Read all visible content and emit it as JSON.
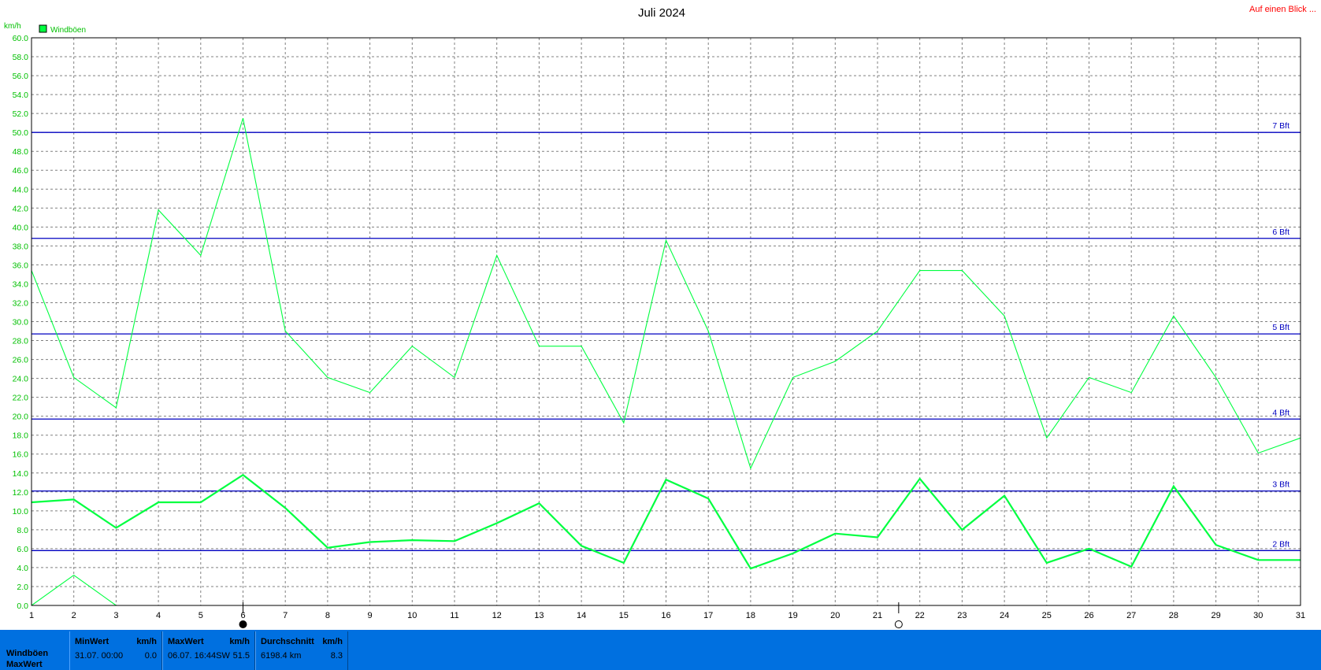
{
  "chart_data": {
    "type": "line",
    "title": "Juli 2024",
    "ylabel": "km/h",
    "xlabel": "",
    "ylim": [
      0,
      60
    ],
    "yticks": [
      "0.0",
      "2.0",
      "4.0",
      "6.0",
      "8.0",
      "10.0",
      "12.0",
      "14.0",
      "16.0",
      "18.0",
      "20.0",
      "22.0",
      "24.0",
      "26.0",
      "28.0",
      "30.0",
      "32.0",
      "34.0",
      "36.0",
      "38.0",
      "40.0",
      "42.0",
      "44.0",
      "46.0",
      "48.0",
      "50.0",
      "52.0",
      "54.0",
      "56.0",
      "58.0",
      "60.0"
    ],
    "x": [
      1,
      2,
      3,
      4,
      5,
      6,
      7,
      8,
      9,
      10,
      11,
      12,
      13,
      14,
      15,
      16,
      17,
      18,
      19,
      20,
      21,
      22,
      23,
      24,
      25,
      26,
      27,
      28,
      29,
      30,
      31
    ],
    "grid": true,
    "legend": "top-left",
    "series": [
      {
        "name": "Windböen",
        "style": "thin",
        "color": "#00ff40",
        "values": [
          35.4,
          24.1,
          20.9,
          41.8,
          37.0,
          51.5,
          29.0,
          24.1,
          22.5,
          27.4,
          24.1,
          37.0,
          27.4,
          27.4,
          19.3,
          38.6,
          29.0,
          14.5,
          24.1,
          25.8,
          29.0,
          35.4,
          35.4,
          30.6,
          17.7,
          24.1,
          22.5,
          30.6,
          24.1,
          16.1,
          17.7
        ]
      },
      {
        "name": "",
        "style": "thick",
        "color": "#00ff40",
        "values": [
          10.9,
          11.2,
          8.2,
          10.9,
          10.9,
          13.8,
          10.3,
          6.1,
          6.7,
          6.9,
          6.8,
          8.7,
          10.8,
          6.3,
          4.5,
          13.3,
          11.3,
          3.9,
          5.5,
          7.6,
          7.2,
          13.4,
          8.0,
          11.6,
          4.5,
          6.0,
          4.1,
          12.6,
          6.4,
          4.8,
          4.8
        ]
      },
      {
        "name": "",
        "style": "thin",
        "color": "#00ff40",
        "values": [
          0.0,
          3.2,
          0.0,
          null,
          null,
          null,
          null,
          null,
          null,
          null,
          null,
          null,
          null,
          null,
          null,
          null,
          null,
          null,
          null,
          null,
          null,
          null,
          null,
          null,
          null,
          null,
          null,
          null,
          null,
          null,
          null
        ]
      }
    ],
    "beaufort_lines": [
      {
        "label": "2 Bft",
        "value": 5.8
      },
      {
        "label": "3 Bft",
        "value": 12.1
      },
      {
        "label": "4 Bft",
        "value": 19.7
      },
      {
        "label": "5 Bft",
        "value": 28.7
      },
      {
        "label": "6 Bft",
        "value": 38.8
      },
      {
        "label": "7 Bft",
        "value": 50.0
      }
    ],
    "moon_markers": [
      {
        "day": 6,
        "phase": "new-moon"
      },
      {
        "day": 21.5,
        "phase": "full-moon"
      }
    ],
    "colors": {
      "axis_text": "#00c000",
      "beaufort": "#0000c0",
      "grid": "#808080",
      "line": "#00ff40"
    }
  },
  "header": {
    "link": "Auf einen Blick ..."
  },
  "stats": {
    "row1_label": "Windböen",
    "row2_label": "MaxWert",
    "min": {
      "head": "MinWert",
      "unit": "km/h",
      "when": "31.07.  00:00",
      "value": "0.0"
    },
    "max": {
      "head": "MaxWert",
      "unit": "km/h",
      "when": "06.07.  16:44SW",
      "value": "51.5"
    },
    "avg": {
      "head": "Durchschnitt",
      "unit": "km/h",
      "when": "6198.4 km",
      "value": "8.3"
    }
  }
}
